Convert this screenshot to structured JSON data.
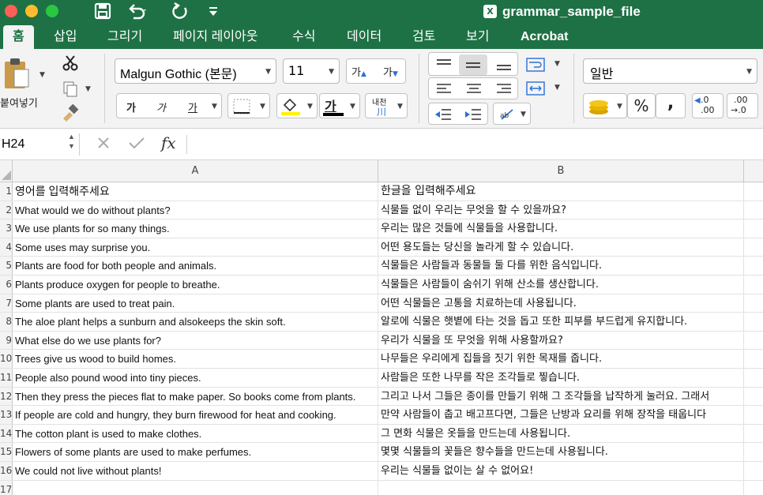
{
  "titlebar": {
    "doc_title": "grammar_sample_file",
    "excel_badge": "X",
    "save_icon": "save-icon",
    "undo_icon": "undo-icon",
    "redo_icon": "redo-icon",
    "customize_icon": "customize-toolbar-icon",
    "colors": {
      "close": "#fe5f57",
      "minimize": "#febc2e",
      "zoom": "#28c840",
      "brand": "#1e7145"
    }
  },
  "tabs": [
    "홈",
    "삽입",
    "그리기",
    "페이지 레이아웃",
    "수식",
    "데이터",
    "검토",
    "보기",
    "Acrobat"
  ],
  "ribbon": {
    "paste_label": "붙여넣기",
    "font_name": "Malgun Gothic (본문)",
    "font_size": "11",
    "increase_font": "가",
    "decrease_font": "가",
    "bold": "가",
    "italic": "가",
    "underline": "가",
    "font_color_glyph": "가",
    "phonetic_top": "내천",
    "phonetic_bottom": "川",
    "number_format": "일반",
    "percent": "%",
    "comma": ",",
    "increase_decimal_top": ".0",
    "increase_decimal_bottom": ".00",
    "decrease_decimal_top": ".00",
    "decrease_decimal_bottom": "→.0"
  },
  "formula_bar": {
    "name_box": "H24",
    "fx": "fx",
    "cancel_icon": "cancel-icon",
    "enter_icon": "check-icon",
    "value": ""
  },
  "sheet": {
    "columns": [
      "A",
      "B"
    ],
    "rows": [
      {
        "num": "1",
        "a": "영어를 입력해주세요",
        "b": "한글을 입력해주세요"
      },
      {
        "num": "2",
        "a": "What would we do without plants?",
        "b": "식물들 없이 우리는 무엇을 할 수 있을까요?"
      },
      {
        "num": "3",
        "a": "We use plants for so many things.",
        "b": "우리는 많은 것들에 식물들을 사용합니다."
      },
      {
        "num": "4",
        "a": "Some uses may surprise you.",
        "b": "어떤 용도들는 당신을 놀라게 할 수 있습니다."
      },
      {
        "num": "5",
        "a": "Plants are food for both people and animals.",
        "b": "식물들은 사람들과 동물들 둘 다를 위한 음식입니다."
      },
      {
        "num": "6",
        "a": "Plants produce oxygen for people to breathe.",
        "b": "식물들은 사람들이 숨쉬기 위해 산소를 생산합니다."
      },
      {
        "num": "7",
        "a": "Some plants are used to treat pain.",
        "b": "어떤 식물들은 고통을 치료하는데 사용됩니다."
      },
      {
        "num": "8",
        "a": "The aloe plant helps a sunburn and alsokeeps the skin soft.",
        "b": "알로에 식물은 햇볕에 타는 것을 돕고 또한 피부를 부드럽게 유지합니다."
      },
      {
        "num": "9",
        "a": "What else do we use plants for?",
        "b": "우리가 식물을 또 무엇을 위해 사용할까요?"
      },
      {
        "num": "10",
        "a": "Trees give us wood to build homes.",
        "b": "나무들은 우리에게 집들을 짓기 위한 목재를 줍니다."
      },
      {
        "num": "11",
        "a": "People also pound wood into tiny pieces.",
        "b": "사람들은 또한 나무를 작은 조각들로 찧습니다."
      },
      {
        "num": "12",
        "a": "Then they press the pieces flat to make paper. So books come from plants.",
        "b": "그리고 나서 그들은 종이를 만들기 위해 그 조각들을 납작하게 눌러요. 그래서"
      },
      {
        "num": "13",
        "a": "If people are cold and hungry, they burn firewood for heat and cooking.",
        "b": "만약 사람들이 춥고 배고프다면, 그들은 난방과 요리를 위해 장작을 태웁니다"
      },
      {
        "num": "14",
        "a": "The cotton plant is used to make clothes.",
        "b": "그 면화 식물은 옷들을 만드는데 사용됩니다."
      },
      {
        "num": "15",
        "a": "Flowers of some plants are used to make perfumes.",
        "b": "몇몇 식물들의 꽃들은 향수들을 만드는데 사용됩니다."
      },
      {
        "num": "16",
        "a": "We could not live without plants!",
        "b": "우리는 식물들 없이는 살 수 없어요!"
      },
      {
        "num": "17",
        "a": "",
        "b": ""
      }
    ]
  }
}
